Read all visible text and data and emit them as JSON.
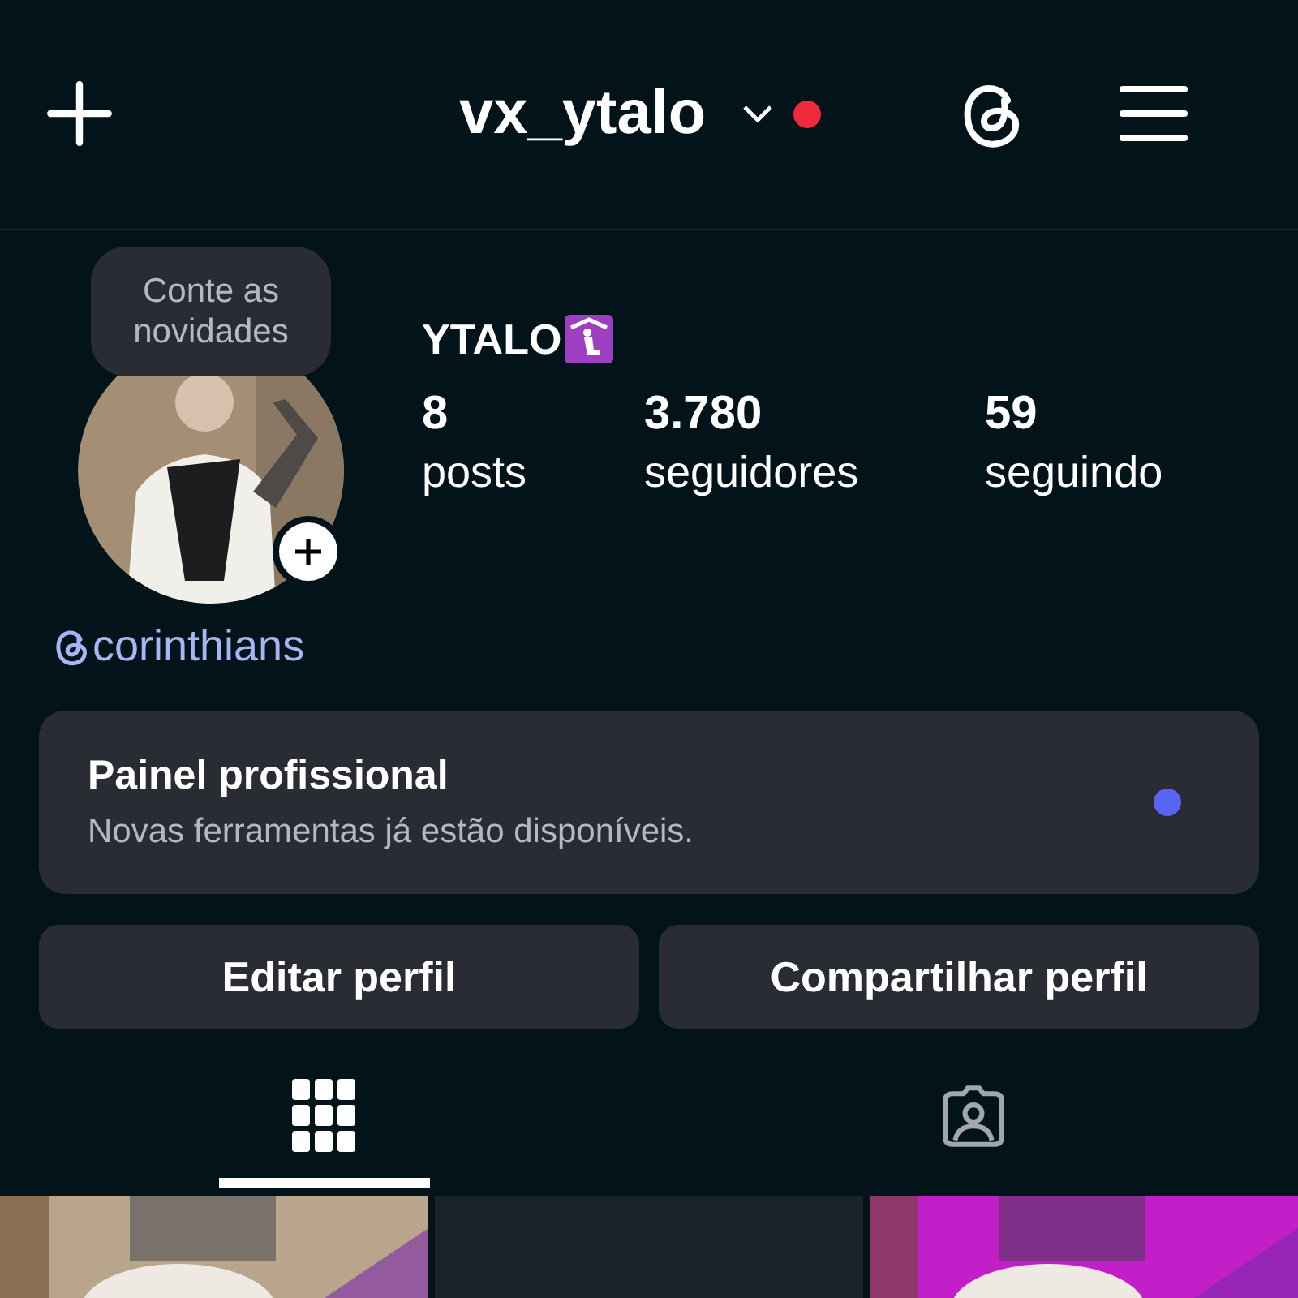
{
  "header": {
    "username": "vx_ytalo",
    "has_notification": true
  },
  "profile": {
    "note": "Conte as novidades",
    "name": "YTALO",
    "stats": [
      {
        "value": "8",
        "label": "posts"
      },
      {
        "value": "3.780",
        "label": "seguidores"
      },
      {
        "value": "59",
        "label": "seguindo"
      }
    ],
    "threads_handle": "corinthians"
  },
  "dashboard": {
    "title": "Painel profissional",
    "subtitle": "Novas ferramentas já estão disponíveis.",
    "unread": true
  },
  "buttons": [
    "Editar perfil",
    "Compartilhar perfil"
  ],
  "tabs": [
    {
      "kind": "grid",
      "selected": true
    },
    {
      "kind": "tagged",
      "selected": false
    }
  ],
  "posts": [
    {
      "kind": "picture"
    },
    {
      "kind": "empty"
    },
    {
      "kind": "picture"
    }
  ]
}
